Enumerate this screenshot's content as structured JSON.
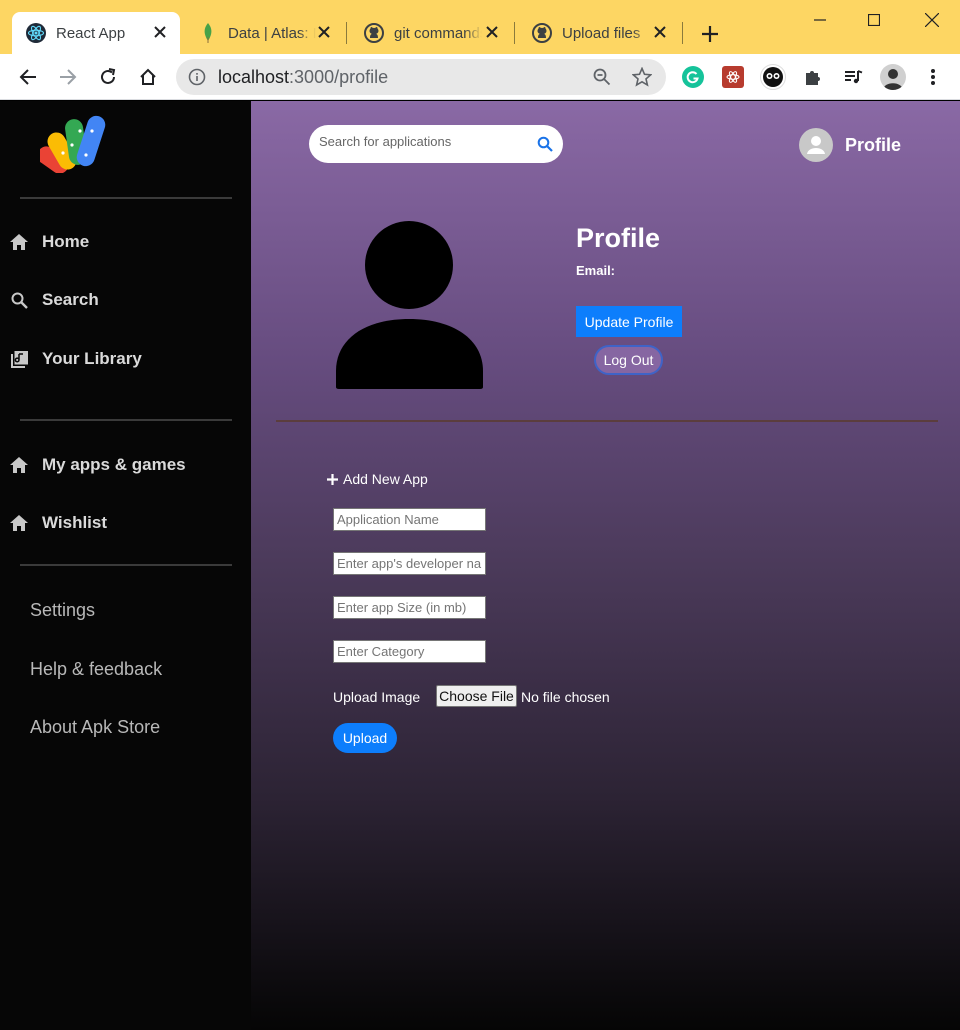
{
  "browser": {
    "tabs": [
      {
        "title": "React App",
        "icon": "react-icon"
      },
      {
        "title": "Data | Atlas: MongoDB",
        "icon": "mongodb-leaf-icon"
      },
      {
        "title": "git commands",
        "icon": "github-icon"
      },
      {
        "title": "Upload files",
        "icon": "github-icon"
      }
    ],
    "url_host": "localhost",
    "url_path": ":3000/profile",
    "colors": {
      "tabstrip": "#fdd663",
      "grammarly": "#15c39a"
    }
  },
  "sidebar": {
    "primary": [
      {
        "label": "Home",
        "icon": "home-icon"
      },
      {
        "label": "Search",
        "icon": "search-icon"
      },
      {
        "label": "Your Library",
        "icon": "library-icon"
      }
    ],
    "secondary": [
      {
        "label": "My apps & games",
        "icon": "home-icon"
      },
      {
        "label": "Wishlist",
        "icon": "home-icon"
      }
    ],
    "links": [
      {
        "label": "Settings"
      },
      {
        "label": "Help & feedback"
      },
      {
        "label": "About Apk Store"
      }
    ]
  },
  "header": {
    "search_placeholder": "Search for applications",
    "profile_label": "Profile"
  },
  "profile": {
    "title": "Profile",
    "email_label": "Email:",
    "update_button": "Update Profile",
    "logout_button": "Log Out"
  },
  "add_app": {
    "title": "Add New App",
    "fields": {
      "name_placeholder": "Application Name",
      "developer_placeholder": "Enter app's developer name",
      "size_placeholder": "Enter app Size (in mb)",
      "category_placeholder": "Enter Category"
    },
    "upload_image_label": "Upload Image",
    "choose_file_label": "Choose File",
    "no_file_text": "No file chosen",
    "upload_button": "Upload"
  },
  "colors": {
    "primary_button": "#0d7efc",
    "sidebar_bg": "#060606",
    "main_gradient_top": "#8a69a5"
  }
}
